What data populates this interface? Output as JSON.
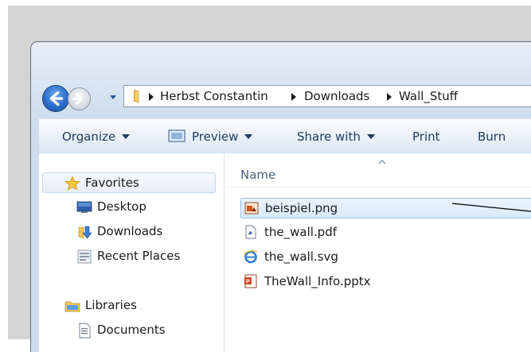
{
  "address_bar": {
    "crumbs": [
      "Herbst Constantin",
      "Downloads",
      "Wall_Stuff"
    ]
  },
  "toolbar": {
    "organize_label": "Organize",
    "preview_label": "Preview",
    "share_label": "Share with",
    "print_label": "Print",
    "burn_label": "Burn"
  },
  "nav_pane": {
    "favorites_label": "Favorites",
    "favorites": [
      "Desktop",
      "Downloads",
      "Recent Places"
    ],
    "libraries_label": "Libraries",
    "libraries": [
      "Documents"
    ]
  },
  "file_list": {
    "column_name": "Name",
    "files": [
      {
        "name": "beispiel.png",
        "icon": "png-image-icon",
        "selected": true
      },
      {
        "name": "the_wall.pdf",
        "icon": "pdf-document-icon",
        "selected": false
      },
      {
        "name": "the_wall.svg",
        "icon": "internet-explorer-icon",
        "selected": false
      },
      {
        "name": "TheWall_Info.pptx",
        "icon": "powerpoint-icon",
        "selected": false
      }
    ]
  },
  "colors": {
    "accent_blue": "#2b6fcc",
    "selection_border": "#99c2ec",
    "toolbar_text": "#1e395b"
  }
}
